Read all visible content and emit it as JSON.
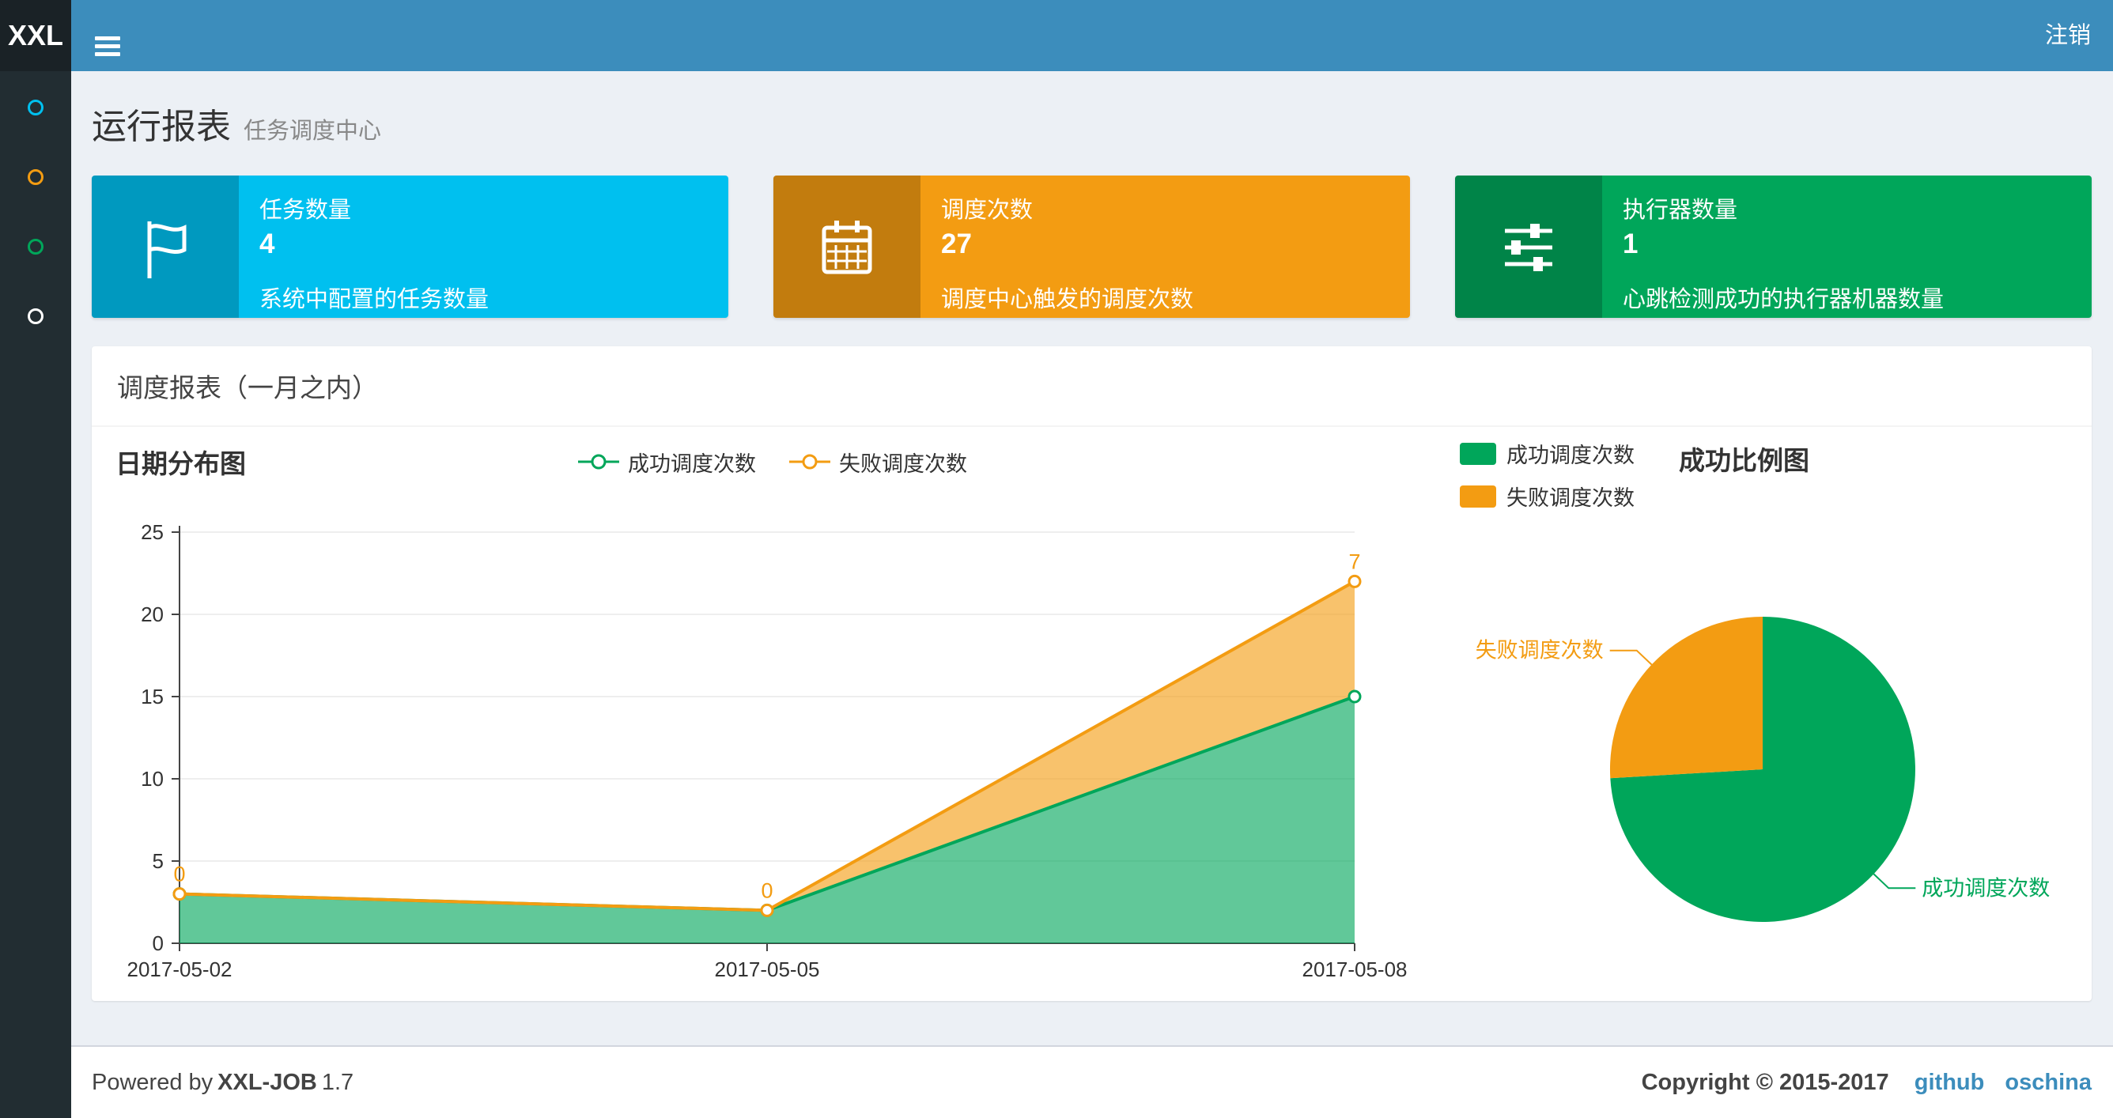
{
  "theme": {
    "navbar_bg": "#3c8dbc",
    "logo_bg": "#1a2226",
    "sidebar_bg": "#222d32",
    "content_bg": "#ecf0f5",
    "link_color": "#3c8dbc"
  },
  "navbar": {
    "logo": "XXL",
    "logout_label": "注销"
  },
  "sidebar": {
    "items": [
      {
        "icon": "circle-icon",
        "color": "#00c0ef"
      },
      {
        "icon": "circle-icon",
        "color": "#f39c12"
      },
      {
        "icon": "circle-icon",
        "color": "#00a65a"
      },
      {
        "icon": "circle-icon",
        "color": "#ffffff"
      }
    ]
  },
  "page_header": {
    "title": "运行报表",
    "subtitle": "任务调度中心"
  },
  "info_boxes": [
    {
      "label": "任务数量",
      "value": "4",
      "description": "系统中配置的任务数量",
      "color": "#00c0ef",
      "icon": "flag-icon"
    },
    {
      "label": "调度次数",
      "value": "27",
      "description": "调度中心触发的调度次数",
      "color": "#f39c12",
      "icon": "calendar-icon"
    },
    {
      "label": "执行器数量",
      "value": "1",
      "description": "心跳检测成功的执行器机器数量",
      "color": "#00a65a",
      "icon": "sliders-icon"
    }
  ],
  "panel": {
    "title": "调度报表（一月之内）"
  },
  "chart_data": [
    {
      "type": "area",
      "title": "日期分布图",
      "x": [
        "2017-05-02",
        "2017-05-05",
        "2017-05-08"
      ],
      "series": [
        {
          "name": "成功调度次数",
          "color": "#00a65a",
          "values": [
            3,
            2,
            15
          ]
        },
        {
          "name": "失败调度次数",
          "color": "#f39c12",
          "values": [
            0,
            0,
            7
          ],
          "labels": [
            "0",
            "0",
            "7"
          ]
        }
      ],
      "stacked": true,
      "xlabel": "",
      "ylabel": "",
      "ylim": [
        0,
        25
      ],
      "yticks": [
        0,
        5,
        10,
        15,
        20,
        25
      ],
      "grid": true,
      "legend_position": "top-center"
    },
    {
      "type": "pie",
      "title": "成功比例图",
      "slices": [
        {
          "name": "成功调度次数",
          "value": 20,
          "color": "#00a65a"
        },
        {
          "name": "失败调度次数",
          "value": 7,
          "color": "#f39c12"
        }
      ],
      "legend_position": "top-left"
    }
  ],
  "footer": {
    "powered_prefix": "Powered by",
    "product": "XXL-JOB",
    "version": "1.7",
    "copyright": "Copyright © 2015-2017",
    "links": [
      "github",
      "oschina"
    ]
  }
}
